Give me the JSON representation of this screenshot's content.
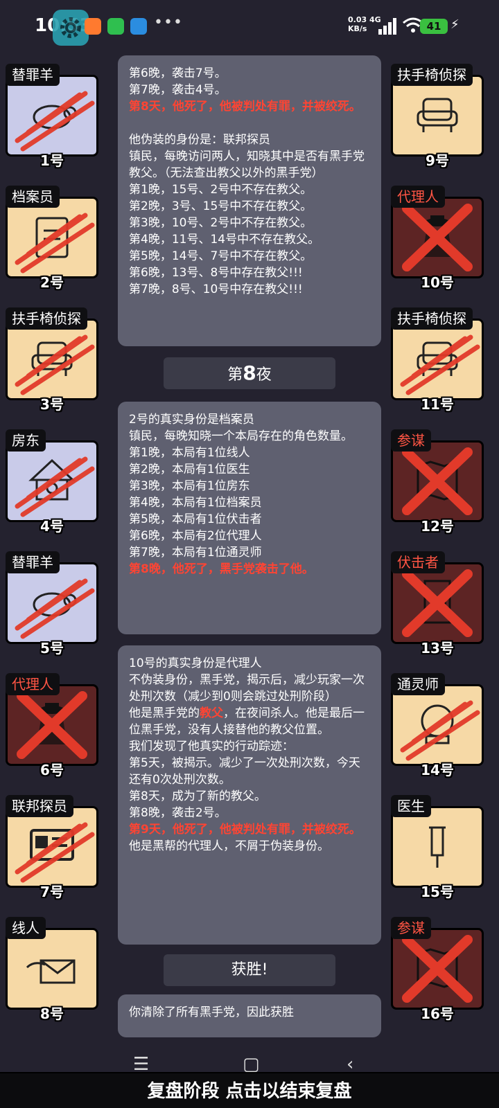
{
  "status_bar": {
    "time": "10:53",
    "net_speed_value": "0.03",
    "net_speed_unit": "KB/s",
    "network_type": "4G",
    "battery": "41"
  },
  "left_cards": [
    {
      "role": "替罪羊",
      "number": "1号",
      "theme": "grey",
      "mark": "claw",
      "icon": "sheep-icon"
    },
    {
      "role": "档案员",
      "number": "2号",
      "theme": "town",
      "mark": "claw",
      "icon": "clipboard-icon"
    },
    {
      "role": "扶手椅侦探",
      "number": "3号",
      "theme": "town",
      "mark": "claw",
      "icon": "armchair-icon"
    },
    {
      "role": "房东",
      "number": "4号",
      "theme": "grey",
      "mark": "claw",
      "icon": "house-icon"
    },
    {
      "role": "替罪羊",
      "number": "5号",
      "theme": "grey",
      "mark": "claw",
      "icon": "sheep-icon"
    },
    {
      "role": "代理人",
      "number": "6号",
      "theme": "dark",
      "mark": "x",
      "icon": "detective-icon"
    },
    {
      "role": "联邦探员",
      "number": "7号",
      "theme": "town",
      "mark": "claw",
      "icon": "badge-icon"
    },
    {
      "role": "线人",
      "number": "8号",
      "theme": "town",
      "mark": "none",
      "icon": "envelope-hand-icon"
    }
  ],
  "right_cards": [
    {
      "role": "扶手椅侦探",
      "number": "9号",
      "theme": "town",
      "mark": "none",
      "icon": "armchair-icon"
    },
    {
      "role": "代理人",
      "number": "10号",
      "theme": "dark",
      "mark": "x",
      "icon": "detective-icon"
    },
    {
      "role": "扶手椅侦探",
      "number": "11号",
      "theme": "town",
      "mark": "claw",
      "icon": "armchair-icon"
    },
    {
      "role": "参谋",
      "number": "12号",
      "theme": "dark",
      "mark": "x",
      "icon": "map-icon"
    },
    {
      "role": "伏击者",
      "number": "13号",
      "theme": "dark",
      "mark": "x",
      "icon": "door-icon"
    },
    {
      "role": "通灵师",
      "number": "14号",
      "theme": "town",
      "mark": "claw",
      "icon": "crystal-ball-icon"
    },
    {
      "role": "医生",
      "number": "15号",
      "theme": "town",
      "mark": "none",
      "icon": "syringe-icon"
    },
    {
      "role": "参谋",
      "number": "16号",
      "theme": "dark",
      "mark": "x",
      "icon": "map-icon"
    }
  ],
  "log": {
    "panel1": {
      "lines_top": [
        "第6晚，袭击7号。",
        "第7晚，袭击4号。"
      ],
      "death": "第8天，他死了，他被判处有罪，并被绞死。",
      "lines_bottom": [
        "他伪装的身份是：联邦探员",
        "镇民，每晚访问两人，知晓其中是否有黑手党教父。（无法查出教父以外的黑手党）",
        "第1晚，15号、2号中不存在教父。",
        "第2晚，3号、15号中不存在教父。",
        "第3晚，10号、2号中不存在教父。",
        "第4晚，11号、14号中不存在教父。",
        "第5晚，14号、7号中不存在教父。",
        "第6晚，13号、8号中存在教父!!!",
        "第7晚，8号、10号中存在教父!!!"
      ]
    },
    "night_prefix": "第",
    "night_number": "8",
    "night_suffix": "夜",
    "panel2": {
      "lines": [
        "2号的真实身份是档案员",
        "镇民，每晚知晓一个本局存在的角色数量。",
        "第1晚，本局有1位线人",
        "第2晚，本局有1位医生",
        "第3晚，本局有1位房东",
        "第4晚，本局有1位档案员",
        "第5晚，本局有1位伏击者",
        "第6晚，本局有2位代理人",
        "第7晚，本局有1位通灵师"
      ],
      "death": "第8晚，他死了，黑手党袭击了他。"
    },
    "panel3": {
      "lines_top": [
        "10号的真实身份是代理人",
        "不伪装身份，黑手党，揭示后，减少玩家一次处刑次数（减少到0则会跳过处刑阶段）"
      ],
      "godfather_pre": "他是黑手党的",
      "godfather_word": "教父",
      "godfather_post": "，在夜间杀人。他是最后一位黑手党，没有人接替他的教父位置。",
      "lines_mid": [
        "我们发现了他真实的行动踪迹：",
        "第5天，被揭示。减少了一次处刑次数，今天还有0次处刑次数。",
        "第8天，成为了新的教父。",
        "第8晚，袭击2号。"
      ],
      "death": "第9天，他死了，他被判处有罪，并被绞死。",
      "lines_bottom": [
        "他是黑帮的代理人，不屑于伪装身份。"
      ]
    },
    "victory_title": "获胜!",
    "victory_text": "你清除了所有黑手党，因此获胜"
  },
  "bottom_banner": "复盘阶段 点击以结束复盘",
  "colors": {
    "background": "#24222f",
    "panel": "#5f6070",
    "death_text": "#ff4433",
    "town_card": "#f6d9a6",
    "neutral_card": "#c9cbe9",
    "mafia_card": "#5d2424",
    "claw_mark": "#e23a2a"
  }
}
